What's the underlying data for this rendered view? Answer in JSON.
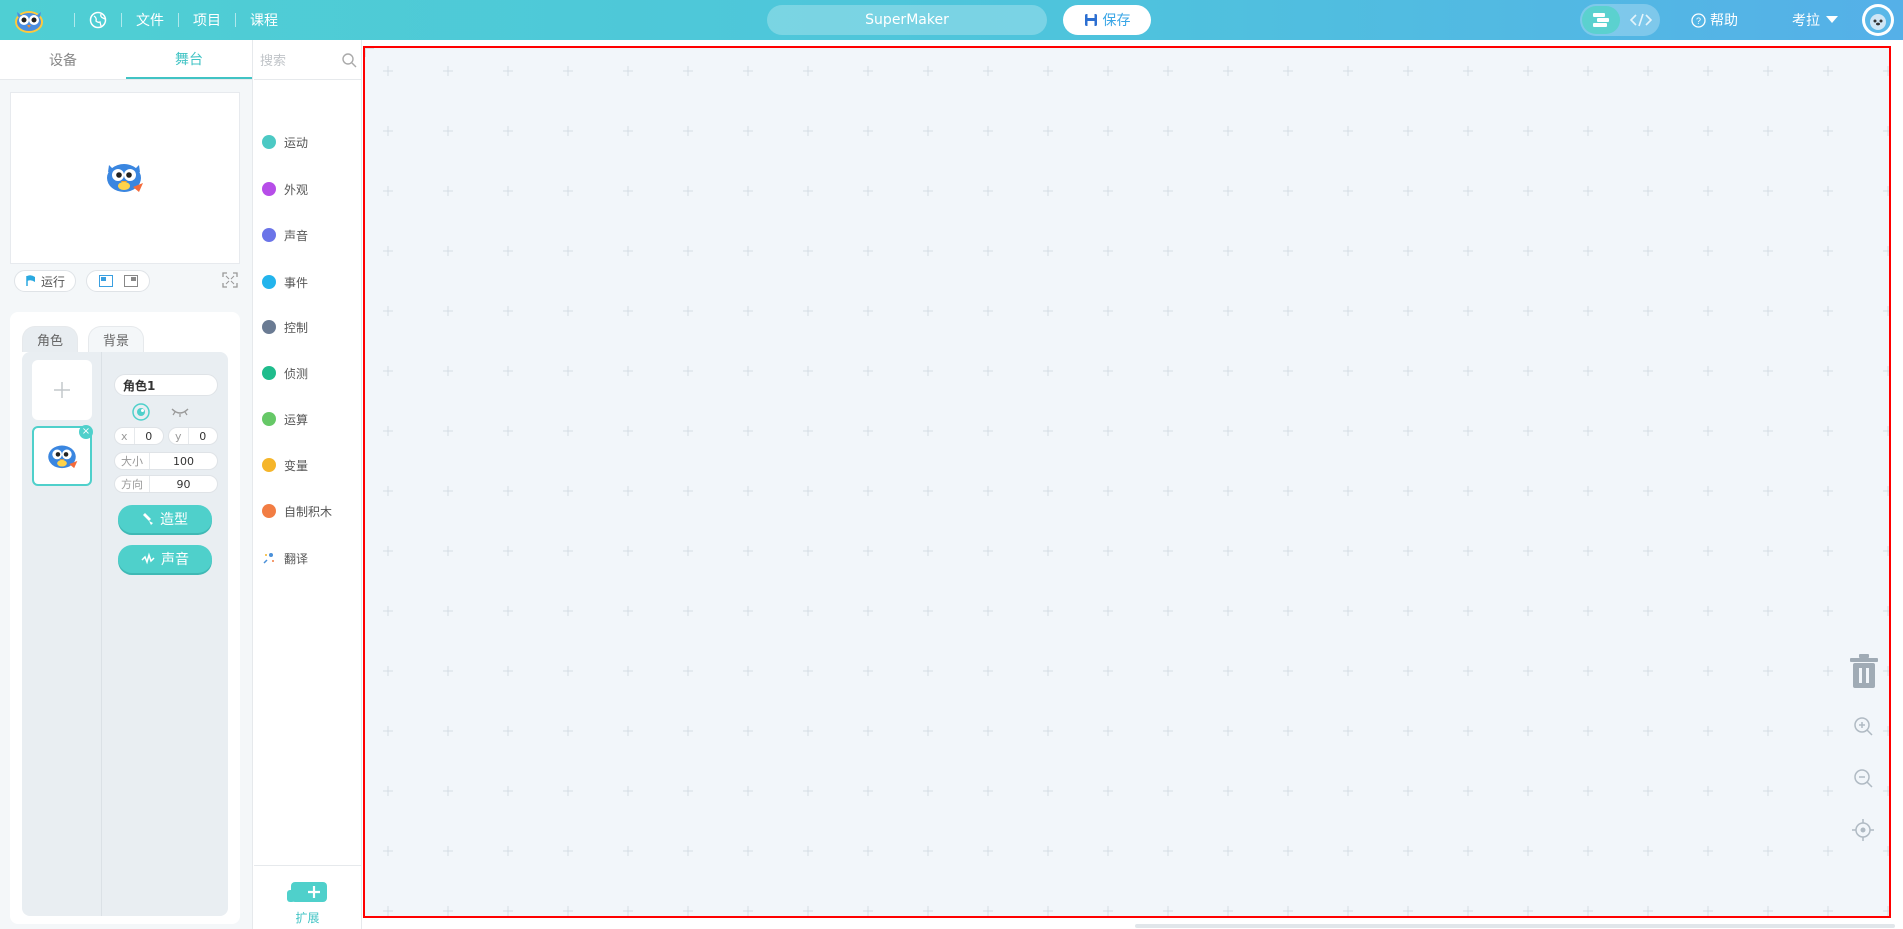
{
  "topbar": {
    "nav": {
      "file": "文件",
      "project": "项目",
      "course": "课程"
    },
    "project_name": "SuperMaker",
    "save_label": "保存",
    "help_label": "帮助",
    "user_name": "考拉"
  },
  "left_panel": {
    "tabs": [
      "设备",
      "舞台"
    ],
    "active_tab": "舞台",
    "run_label": "运行",
    "sprite_tabs": [
      "角色",
      "背景"
    ],
    "sprite": {
      "name": "角色1",
      "x_label": "x",
      "x": "0",
      "y_label": "y",
      "y": "0",
      "size_label": "大小",
      "size": "100",
      "direction_label": "方向",
      "direction": "90",
      "costume_button": "造型",
      "sound_button": "声音"
    }
  },
  "categories": {
    "search_placeholder": "搜索",
    "items": [
      {
        "label": "运动",
        "color": "#4cc9c4"
      },
      {
        "label": "外观",
        "color": "#b64de8"
      },
      {
        "label": "声音",
        "color": "#6b74e8"
      },
      {
        "label": "事件",
        "color": "#23b4ec"
      },
      {
        "label": "控制",
        "color": "#6a7b93"
      },
      {
        "label": "侦测",
        "color": "#1fbc8c"
      },
      {
        "label": "运算",
        "color": "#66c867"
      },
      {
        "label": "变量",
        "color": "#f5b52a"
      },
      {
        "label": "自制积木",
        "color": "#f27d43"
      },
      {
        "label": "翻译",
        "color": "#4a90d9"
      }
    ],
    "extension_label": "扩展"
  },
  "colors": {
    "accent": "#4fd0cb",
    "canvas_bg": "#f2f6fa",
    "highlight_border": "#ff0000"
  }
}
